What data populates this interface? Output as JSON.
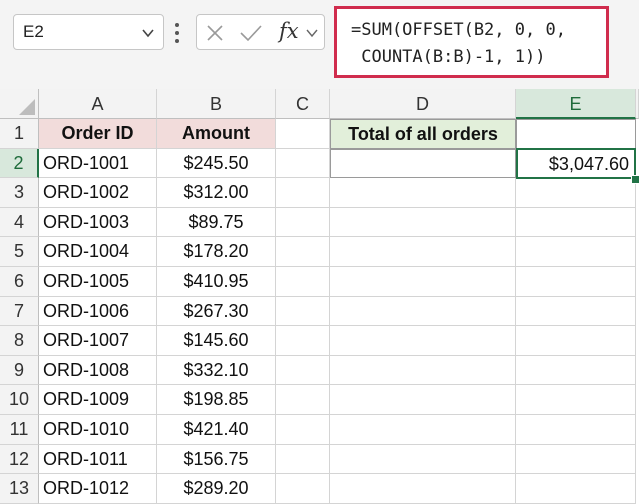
{
  "name_box": {
    "value": "E2"
  },
  "formula_bar": {
    "fx_label": "fx",
    "formula_line1": "=SUM(OFFSET(B2, 0, 0,",
    "formula_line2": " COUNTA(B:B)-1, 1))",
    "highlight_color": "#d02c4d"
  },
  "columns": [
    "A",
    "B",
    "C",
    "D",
    "E"
  ],
  "active_column": "E",
  "active_row": "2",
  "rows": [
    "1",
    "2",
    "3",
    "4",
    "5",
    "6",
    "7",
    "8",
    "9",
    "10",
    "11",
    "12",
    "13"
  ],
  "headers": {
    "order_id": "Order ID",
    "amount": "Amount"
  },
  "orders": [
    {
      "id": "ORD-1001",
      "amount": "$245.50"
    },
    {
      "id": "ORD-1002",
      "amount": "$312.00"
    },
    {
      "id": "ORD-1003",
      "amount": "$89.75"
    },
    {
      "id": "ORD-1004",
      "amount": "$178.20"
    },
    {
      "id": "ORD-1005",
      "amount": "$410.95"
    },
    {
      "id": "ORD-1006",
      "amount": "$267.30"
    },
    {
      "id": "ORD-1007",
      "amount": "$145.60"
    },
    {
      "id": "ORD-1008",
      "amount": "$332.10"
    },
    {
      "id": "ORD-1009",
      "amount": "$198.85"
    },
    {
      "id": "ORD-1010",
      "amount": "$421.40"
    },
    {
      "id": "ORD-1011",
      "amount": "$156.75"
    },
    {
      "id": "ORD-1012",
      "amount": "$289.20"
    }
  ],
  "summary": {
    "label": "Total of all orders",
    "value": "$3,047.60"
  },
  "colors": {
    "header_pink": "#f2dcdb",
    "header_green": "#e2efda",
    "selection": "#217346"
  },
  "icons": [
    "chevron-down-icon",
    "more-options-icon",
    "cancel-icon",
    "enter-icon",
    "insert-function-icon",
    "select-all-icon"
  ]
}
